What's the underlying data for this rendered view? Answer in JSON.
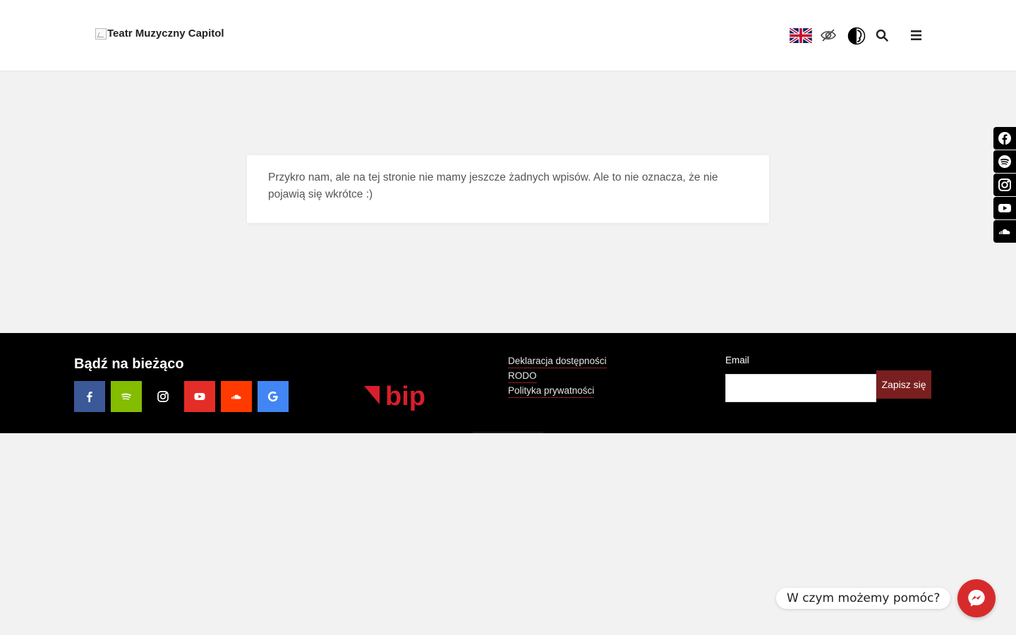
{
  "header": {
    "logo_alt": "Teatr Muzyczny Capitol",
    "icons": [
      "uk-flag-icon",
      "eye-slash-icon",
      "contrast-icon",
      "search-icon",
      "menu-icon"
    ]
  },
  "notice": {
    "text": "Przykro nam, ale na tej stronie nie mamy jeszcze żadnych wpisów. Ale to nie oznacza, że nie pojawią się wkrótce :)"
  },
  "sidebar": {
    "icons": [
      "facebook-icon",
      "spotify-icon",
      "instagram-icon",
      "youtube-icon",
      "soundcloud-icon"
    ]
  },
  "footer": {
    "title": "Bądź na bieżąco",
    "social": [
      {
        "name": "facebook",
        "color": "#3b5998"
      },
      {
        "name": "spotify",
        "color": "#84bd00"
      },
      {
        "name": "instagram",
        "color": "#000000"
      },
      {
        "name": "youtube",
        "color": "#e52d27"
      },
      {
        "name": "soundcloud",
        "color": "#ff3a00"
      },
      {
        "name": "google",
        "color": "#4285f4"
      }
    ],
    "bip_logo": "bip",
    "links": [
      "Deklaracja dostępności",
      "RODO",
      "Polityka prywatności"
    ],
    "email_label": "Email",
    "email_value": "",
    "subscribe_label": "Zapisz się"
  },
  "chat": {
    "prompt": "W czym możemy pomóc?"
  }
}
